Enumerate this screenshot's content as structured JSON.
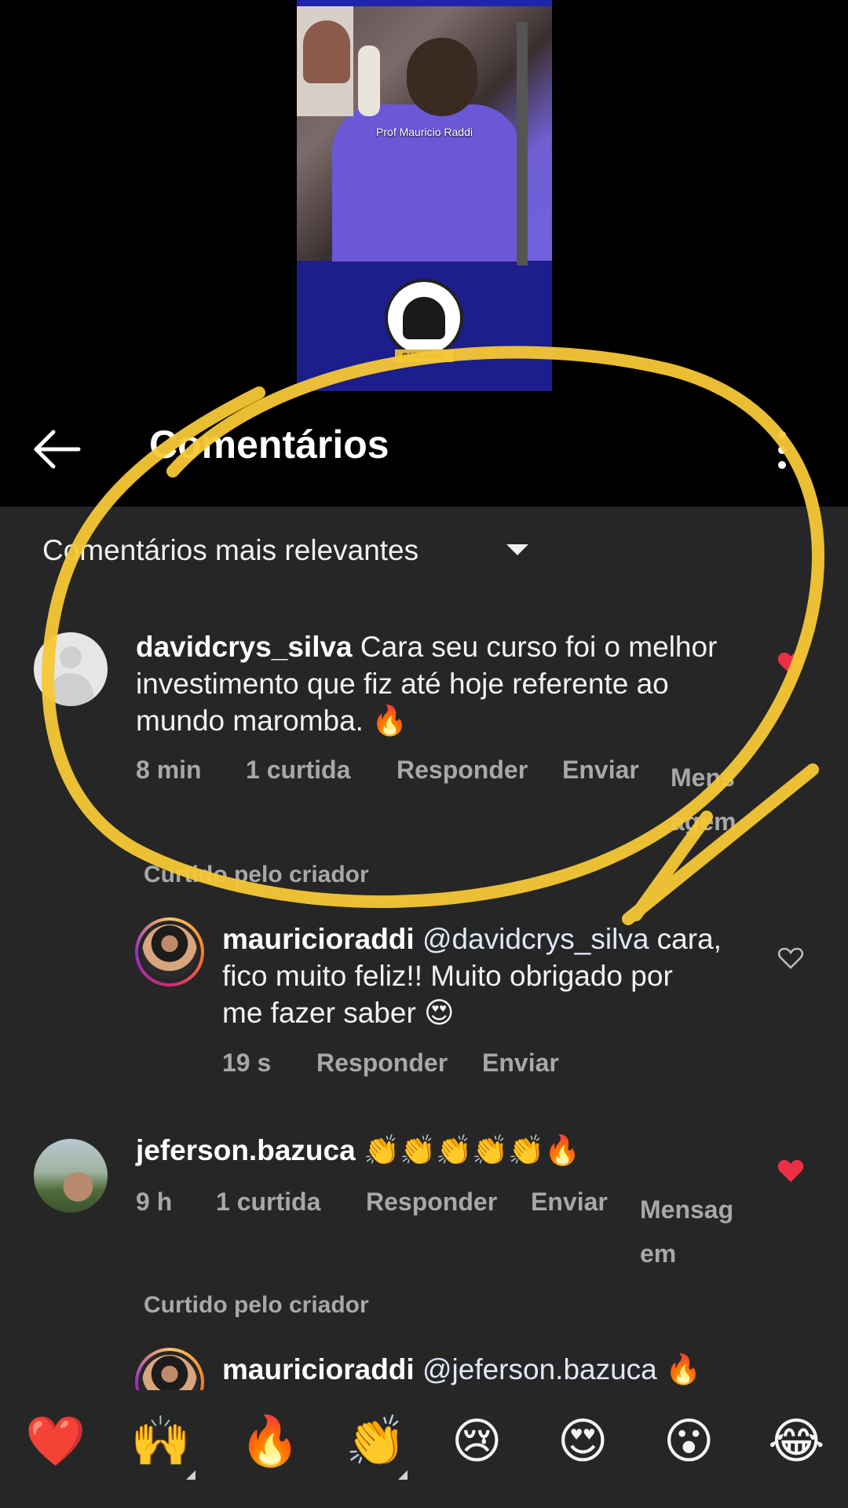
{
  "video": {
    "caption": "Prof Mauricio Raddi",
    "logo_text": "RADDICORE"
  },
  "header": {
    "title": "Comentários",
    "back_icon": "arrow-left-icon",
    "more_icon": "more-vertical-icon"
  },
  "sort": {
    "label": "Comentários mais relevantes",
    "caret_icon": "caret-down-icon"
  },
  "comments": [
    {
      "username": "davidcrys_silva",
      "text_line1": "Cara seu curso foi o melhor",
      "text_line2": "investimento que fiz até hoje referente ao",
      "text_line3": "mundo maromba. 🔥",
      "time": "8 min",
      "likes": "1 curtida",
      "reply": "Responder",
      "send": "Enviar",
      "message_line1": "Mens",
      "message_line2": "agem",
      "liked": true,
      "liked_by_creator": "Curtido pelo criador",
      "replies": [
        {
          "username": "mauricioraddi",
          "mention": "@davidcrys_silva",
          "text_line1_tail": " cara,",
          "text_line2": "fico muito feliz!! Muito obrigado por",
          "text_line3": "me fazer saber 😍",
          "time": "19 s",
          "reply": "Responder",
          "send": "Enviar",
          "liked": false
        }
      ]
    },
    {
      "username": "jeferson.bazuca",
      "text_line1": "👏👏👏👏👏🔥",
      "time": "9 h",
      "likes": "1 curtida",
      "reply": "Responder",
      "send": "Enviar",
      "message_line1": "Mensag",
      "message_line2": "em",
      "liked": true,
      "liked_by_creator": "Curtido pelo criador",
      "replies": [
        {
          "username": "mauricioraddi",
          "mention": "@jeferson.bazuca",
          "text_line1_tail": " 🔥",
          "liked": false
        }
      ]
    }
  ],
  "reactions": [
    "❤️",
    "🙌",
    "🔥",
    "👏",
    "😢",
    "😍",
    "😮",
    "😂"
  ],
  "colors": {
    "background": "#262626",
    "header": "#000000",
    "heart_liked": "#ed2f45",
    "annotation_yellow": "#f7c835"
  }
}
